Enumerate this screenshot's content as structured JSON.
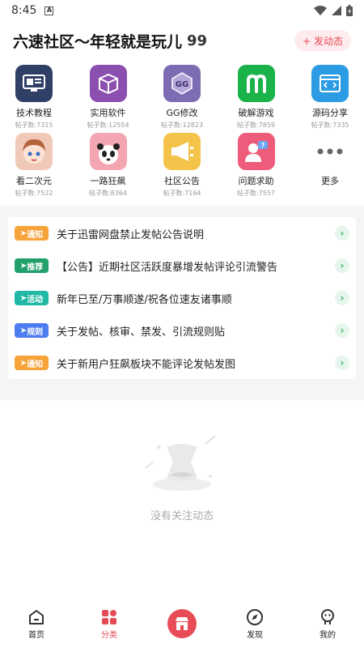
{
  "status_bar": {
    "time": "8:45",
    "app_icon_letter": "A"
  },
  "header": {
    "title": "六速社区～年轻就是玩儿",
    "quote_mark": "99",
    "post_button": "+ 发动态"
  },
  "categories": [
    {
      "name": "技术教程",
      "count": "帖子数:7315",
      "icon": "monitor-icon",
      "color": "#2f3f66"
    },
    {
      "name": "实用软件",
      "count": "帖子数:12554",
      "icon": "box-icon",
      "color": "#8b4fb0"
    },
    {
      "name": "GG修改",
      "count": "帖子数:12823",
      "icon": "gg-icon",
      "color": "#7d6bb3"
    },
    {
      "name": "破解游戏",
      "count": "帖子数:7859",
      "icon": "m-logo-icon",
      "color": "#19b34a"
    },
    {
      "name": "源码分享",
      "count": "帖子数:7335",
      "icon": "code-icon",
      "color": "#2b9be4"
    },
    {
      "name": "看二次元",
      "count": "帖子数:7522",
      "icon": "anime-icon",
      "color": "#f1c9b8"
    },
    {
      "name": "一路狂飙",
      "count": "帖子数:8364",
      "icon": "panda-icon",
      "color": "#f3a6b2"
    },
    {
      "name": "社区公告",
      "count": "帖子数:7164",
      "icon": "megaphone-icon",
      "color": "#f4c34a"
    },
    {
      "name": "问题求助",
      "count": "帖子数:7557",
      "icon": "help-icon",
      "color": "#ef5b7a"
    },
    {
      "name": "更多",
      "count": "",
      "icon": "more-icon",
      "color": "#ffffff"
    }
  ],
  "notices": [
    {
      "tag": "通知",
      "tag_color": "#f6a33a",
      "text": "关于迅雷网盘禁止发帖公告说明"
    },
    {
      "tag": "推荐",
      "tag_color": "#22a06b",
      "text": "【公告】近期社区活跃度暴增发帖评论引流警告"
    },
    {
      "tag": "活动",
      "tag_color": "#22b8a6",
      "text": "新年已至/万事顺遂/祝各位速友诸事顺"
    },
    {
      "tag": "规则",
      "tag_color": "#4c7cf0",
      "text": "关于发帖、核审、禁发、引流规则贴"
    },
    {
      "tag": "通知",
      "tag_color": "#f6a33a",
      "text": "关于新用户狂飙板块不能评论发帖发图"
    }
  ],
  "empty_state": {
    "text": "没有关注动态"
  },
  "tabbar": {
    "home": "首页",
    "category": "分类",
    "discover": "发现",
    "mine": "我的"
  },
  "colors": {
    "accent": "#e54a57",
    "notice_arrow": "#3bb26a"
  }
}
